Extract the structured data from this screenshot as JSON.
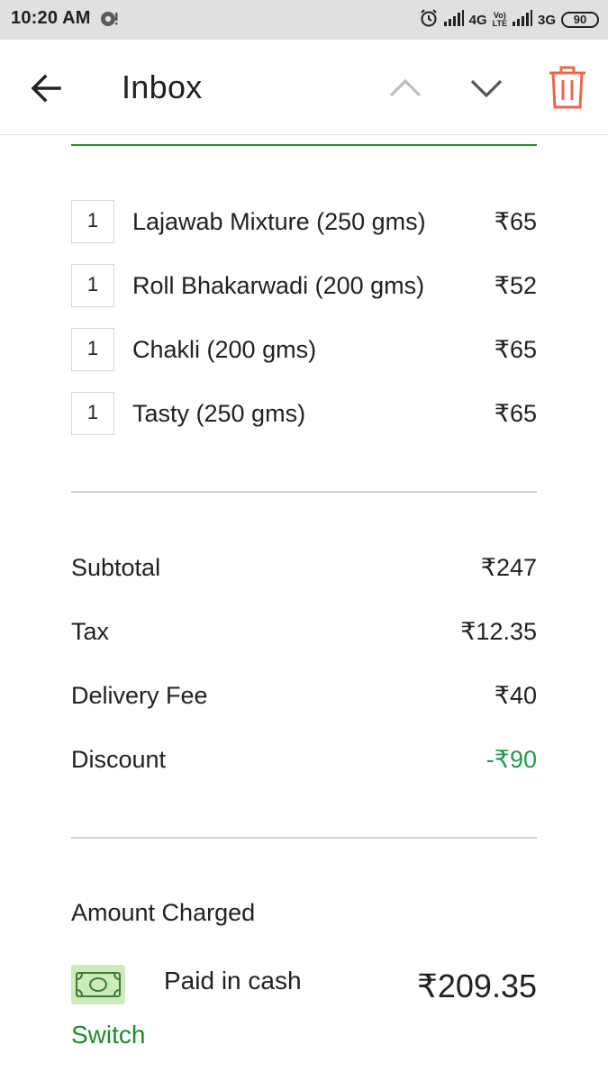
{
  "status_bar": {
    "time": "10:20 AM",
    "net1": "4G",
    "volte_top": "Vo)",
    "volte_bottom": "LTE",
    "net2": "3G",
    "battery": "90"
  },
  "toolbar": {
    "title": "Inbox"
  },
  "order": {
    "items": [
      {
        "qty": "1",
        "name": "Lajawab Mixture (250 gms)",
        "price": "₹65"
      },
      {
        "qty": "1",
        "name": "Roll Bhakarwadi (200 gms)",
        "price": "₹52"
      },
      {
        "qty": "1",
        "name": "Chakli (200 gms)",
        "price": "₹65"
      },
      {
        "qty": "1",
        "name": "Tasty (250 gms)",
        "price": "₹65"
      }
    ],
    "summary": [
      {
        "label": "Subtotal",
        "value": "₹247"
      },
      {
        "label": "Tax",
        "value": "₹12.35"
      },
      {
        "label": "Delivery Fee",
        "value": "₹40"
      },
      {
        "label": "Discount",
        "value": "-₹90"
      }
    ],
    "amount_heading": "Amount Charged",
    "payment_method": "Paid in cash",
    "total": "₹209.35",
    "switch_label": "Switch"
  },
  "colors": {
    "accent_green": "#1e8c2a",
    "discount_green": "#1e9c4a",
    "delete_orange": "#e8694a"
  }
}
